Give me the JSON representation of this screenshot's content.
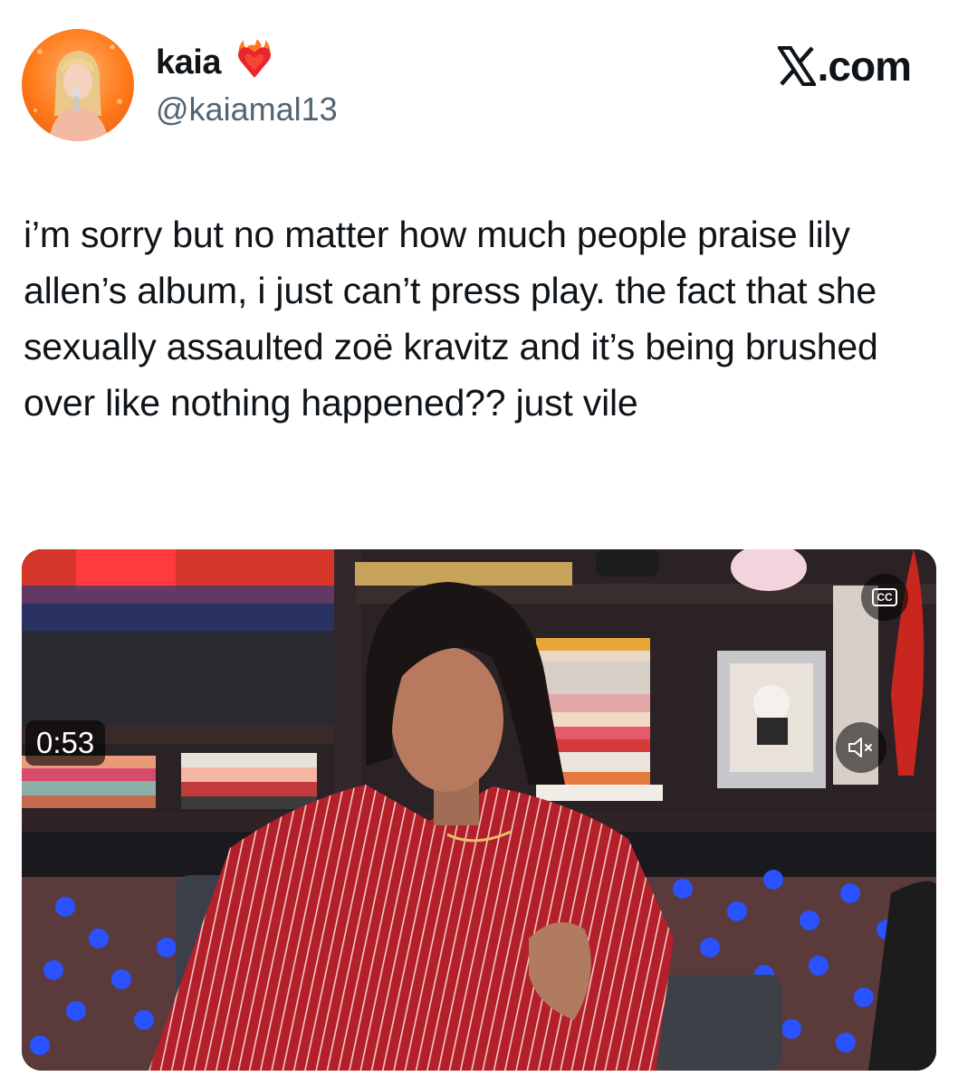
{
  "user": {
    "display_name": "kaia",
    "handle": "@kaiamal13",
    "avatar_icon": "profile-photo",
    "badge_icon": "heart-on-fire-emoji"
  },
  "brand": {
    "label": ".com",
    "icon": "x-logo"
  },
  "tweet": {
    "text": "i’m sorry but no matter how much people praise lily allen’s album, i just can’t press play. the fact that she sexually assaulted zoë kravitz and it’s being brushed over like nothing happened?? just vile"
  },
  "video": {
    "duration": "0:53",
    "cc_label": "CC",
    "cc_icon": "closed-captions-icon",
    "mute_icon": "speaker-muted-icon"
  },
  "colors": {
    "text": "#0f1419",
    "secondary_text": "#536471",
    "background": "#ffffff"
  }
}
